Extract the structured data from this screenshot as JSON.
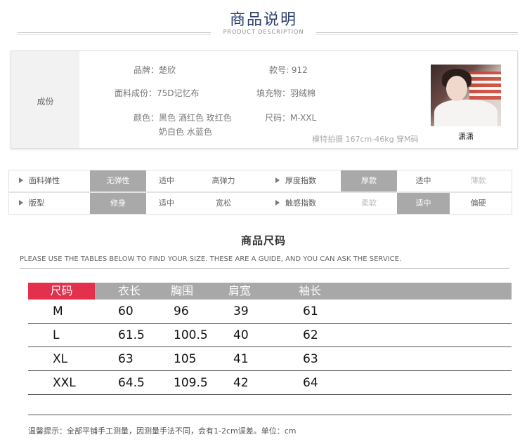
{
  "header": {
    "title": "商品说明",
    "subtitle": "PRODUCT DESCRIPTION"
  },
  "info": {
    "section_label": "成份",
    "brand": "品牌：楚欣",
    "style_no": "款号: 912",
    "fabric": "面料成份：75D记忆布",
    "filling": "填充物：羽绒棉",
    "colors_line1": "颜色：黑色 酒红色 玫红色",
    "colors_line2": "奶白色 水蓝色",
    "sizes": "尺码：M-XXL",
    "model_note": "模特拍摄  167cm-46kg  穿M码",
    "model_name": "潇潇"
  },
  "attributes": {
    "row1": {
      "left_label": "面料弹性",
      "left_options": [
        "无弹性",
        "适中",
        "高弹力"
      ],
      "right_label": "厚度指数",
      "right_options": [
        "厚款",
        "适中",
        "薄款"
      ]
    },
    "row2": {
      "left_label": "版型",
      "left_options": [
        "修身",
        "适中",
        "宽松"
      ],
      "right_label": "触感指数",
      "right_options": [
        "柔软",
        "适中",
        "偏硬"
      ]
    }
  },
  "size_section": {
    "title": "商品尺码",
    "note": "PLEASE USE THE TABLES BELOW TO FIND YOUR SIZE. THESE ARE A GUIDE, AND YOU CAN ASK THE SERVICE.",
    "headers": [
      "尺码",
      "衣长",
      "胸围",
      "肩宽",
      "袖长"
    ],
    "rows": [
      [
        "M",
        "60",
        "96",
        "39",
        "61"
      ],
      [
        "L",
        "61.5",
        "100.5",
        "40",
        "62"
      ],
      [
        "XL",
        "63",
        "105",
        "41",
        "63"
      ],
      [
        "XXL",
        "64.5",
        "109.5",
        "42",
        "64"
      ]
    ],
    "footer": "温馨提示：全部平铺手工测量，因测量手法不同，会有1-2cm误差。单位：cm"
  }
}
